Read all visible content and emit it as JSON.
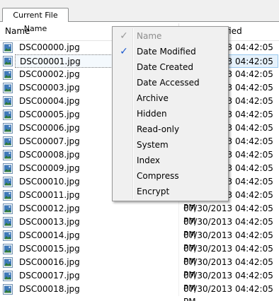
{
  "tab": {
    "label": "Current File Name"
  },
  "columns": {
    "name": "Name",
    "date": "Date Modified"
  },
  "rows": [
    {
      "name": "DSC00000.jpg",
      "date": "07/30/2013 04:42:05 PM"
    },
    {
      "name": "DSC00001.jpg",
      "date": "07/30/2013 04:42:05 PM",
      "selected": true
    },
    {
      "name": "DSC00002.jpg",
      "date": "07/30/2013 04:42:05 PM"
    },
    {
      "name": "DSC00003.jpg",
      "date": "07/30/2013 04:42:05 PM"
    },
    {
      "name": "DSC00004.jpg",
      "date": "07/30/2013 04:42:05 PM"
    },
    {
      "name": "DSC00005.jpg",
      "date": "07/30/2013 04:42:05 PM"
    },
    {
      "name": "DSC00006.jpg",
      "date": "07/30/2013 04:42:05 PM"
    },
    {
      "name": "DSC00007.jpg",
      "date": "07/30/2013 04:42:05 PM"
    },
    {
      "name": "DSC00008.jpg",
      "date": "07/30/2013 04:42:05 PM"
    },
    {
      "name": "DSC00009.jpg",
      "date": "07/30/2013 04:42:05 PM"
    },
    {
      "name": "DSC00010.jpg",
      "date": "07/30/2013 04:42:05 PM"
    },
    {
      "name": "DSC00011.jpg",
      "date": "07/30/2013 04:42:05 PM"
    },
    {
      "name": "DSC00012.jpg",
      "date": "07/30/2013 04:42:05 PM"
    },
    {
      "name": "DSC00013.jpg",
      "date": "07/30/2013 04:42:05 PM"
    },
    {
      "name": "DSC00014.jpg",
      "date": "07/30/2013 04:42:05 PM"
    },
    {
      "name": "DSC00015.jpg",
      "date": "07/30/2013 04:42:05 PM"
    },
    {
      "name": "DSC00016.jpg",
      "date": "07/30/2013 04:42:05 PM"
    },
    {
      "name": "DSC00017.jpg",
      "date": "07/30/2013 04:42:05 PM"
    },
    {
      "name": "DSC00018.jpg",
      "date": "07/30/2013 04:42:05 PM"
    }
  ],
  "file_icon": "image-file-icon",
  "context_menu": {
    "items": [
      {
        "label": "Name",
        "checked": true,
        "disabled": true
      },
      {
        "label": "Date Modified",
        "checked": true,
        "disabled": false
      },
      {
        "label": "Date Created",
        "checked": false,
        "disabled": false
      },
      {
        "label": "Date Accessed",
        "checked": false,
        "disabled": false
      },
      {
        "label": "Archive",
        "checked": false,
        "disabled": false
      },
      {
        "label": "Hidden",
        "checked": false,
        "disabled": false
      },
      {
        "label": "Read-only",
        "checked": false,
        "disabled": false
      },
      {
        "label": "System",
        "checked": false,
        "disabled": false
      },
      {
        "label": "Index",
        "checked": false,
        "disabled": false
      },
      {
        "label": "Compress",
        "checked": false,
        "disabled": false
      },
      {
        "label": "Encrypt",
        "checked": false,
        "disabled": false
      }
    ]
  },
  "colors": {
    "check": "#1b59cf",
    "selection": "#e5f1fb"
  }
}
